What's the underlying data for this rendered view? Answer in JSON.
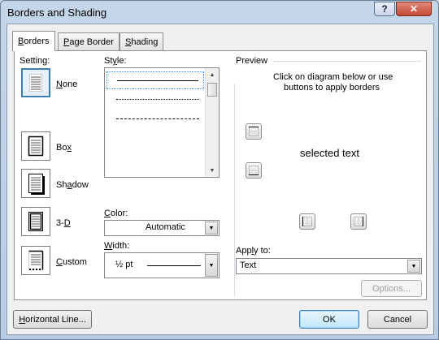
{
  "window": {
    "title": "Borders and Shading",
    "help_glyph": "?",
    "close_glyph": "✕"
  },
  "tabs": [
    {
      "label": "Borders",
      "underline": "B",
      "rest": "orders"
    },
    {
      "label": "Page Border",
      "underline": "P",
      "rest": "age Border"
    },
    {
      "label": "Shading",
      "underline": "S",
      "rest": "hading"
    }
  ],
  "setting": {
    "label": "Setting:",
    "options": [
      {
        "label": "None",
        "underline": "N",
        "rest": "one"
      },
      {
        "label": "Box",
        "pre": "Bo",
        "underline": "x",
        "rest": ""
      },
      {
        "label": "Shadow",
        "pre": "Sh",
        "underline": "a",
        "rest": "dow"
      },
      {
        "label": "3-D",
        "pre": "3-",
        "underline": "D",
        "rest": ""
      },
      {
        "label": "Custom",
        "underline": "C",
        "rest": "ustom"
      }
    ]
  },
  "style": {
    "label": "Style:",
    "pre": "St",
    "underline": "y",
    "rest": "le:"
  },
  "color": {
    "label": "Color:",
    "underline": "C",
    "rest": "olor:",
    "value": "Automatic"
  },
  "width": {
    "label": "Width:",
    "underline": "W",
    "rest": "idth:",
    "value": "½ pt"
  },
  "preview": {
    "label": "Preview",
    "instructions_line1": "Click on diagram below or use",
    "instructions_line2": "buttons to apply borders",
    "sample_text": "selected text"
  },
  "apply_to": {
    "label": "Apply to:",
    "pre": "App",
    "underline": "l",
    "rest": "y to:",
    "value": "Text"
  },
  "buttons": {
    "options": "Options...",
    "horizontal_line": "Horizontal Line...",
    "horizontal_underline": "H",
    "horizontal_rest": "orizontal Line...",
    "ok": "OK",
    "cancel": "Cancel"
  }
}
